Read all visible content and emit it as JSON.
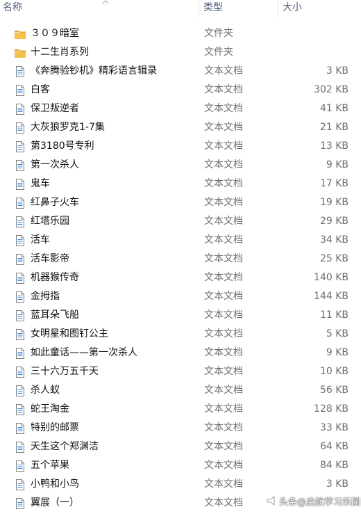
{
  "header": {
    "name_label": "名称",
    "type_label": "类型",
    "size_label": "大小"
  },
  "rows": [
    {
      "name": "３０９暗室",
      "type": "文件夹",
      "size": "",
      "icon": "folder-icon"
    },
    {
      "name": "十二生肖系列",
      "type": "文件夹",
      "size": "",
      "icon": "folder-icon"
    },
    {
      "name": "《奔腾验钞机》精彩语言辑录",
      "type": "文本文档",
      "size": "3 KB",
      "icon": "text-document-icon"
    },
    {
      "name": "白客",
      "type": "文本文档",
      "size": "302 KB",
      "icon": "text-document-icon"
    },
    {
      "name": "保卫叛逆者",
      "type": "文本文档",
      "size": "41 KB",
      "icon": "text-document-icon"
    },
    {
      "name": "大灰狼罗克1-7集",
      "type": "文本文档",
      "size": "21 KB",
      "icon": "text-document-icon"
    },
    {
      "name": "第3180号专利",
      "type": "文本文档",
      "size": "13 KB",
      "icon": "text-document-icon"
    },
    {
      "name": "第一次杀人",
      "type": "文本文档",
      "size": "9 KB",
      "icon": "text-document-icon"
    },
    {
      "name": "鬼车",
      "type": "文本文档",
      "size": "17 KB",
      "icon": "text-document-icon"
    },
    {
      "name": "红鼻子火车",
      "type": "文本文档",
      "size": "19 KB",
      "icon": "text-document-icon"
    },
    {
      "name": "红塔乐园",
      "type": "文本文档",
      "size": "29 KB",
      "icon": "text-document-icon"
    },
    {
      "name": "活车",
      "type": "文本文档",
      "size": "34 KB",
      "icon": "text-document-icon"
    },
    {
      "name": "活车影帝",
      "type": "文本文档",
      "size": "25 KB",
      "icon": "text-document-icon"
    },
    {
      "name": "机器猴传奇",
      "type": "文本文档",
      "size": "140 KB",
      "icon": "text-document-icon"
    },
    {
      "name": "金拇指",
      "type": "文本文档",
      "size": "144 KB",
      "icon": "text-document-icon"
    },
    {
      "name": "蓝耳朵飞船",
      "type": "文本文档",
      "size": "11 KB",
      "icon": "text-document-icon"
    },
    {
      "name": "女明星和图钉公主",
      "type": "文本文档",
      "size": "5 KB",
      "icon": "text-document-icon"
    },
    {
      "name": "如此童话——第一次杀人",
      "type": "文本文档",
      "size": "9 KB",
      "icon": "text-document-icon"
    },
    {
      "name": "三十六万五千天",
      "type": "文本文档",
      "size": "10 KB",
      "icon": "text-document-icon"
    },
    {
      "name": "杀人蚁",
      "type": "文本文档",
      "size": "56 KB",
      "icon": "text-document-icon"
    },
    {
      "name": "蛇王淘金",
      "type": "文本文档",
      "size": "128 KB",
      "icon": "text-document-icon"
    },
    {
      "name": "特别的邮票",
      "type": "文本文档",
      "size": "33 KB",
      "icon": "text-document-icon"
    },
    {
      "name": "天生这个郑渊洁",
      "type": "文本文档",
      "size": "64 KB",
      "icon": "text-document-icon"
    },
    {
      "name": "五个苹果",
      "type": "文本文档",
      "size": "84 KB",
      "icon": "text-document-icon"
    },
    {
      "name": "小鸭和小鸟",
      "type": "文本文档",
      "size": "3 KB",
      "icon": "text-document-icon"
    },
    {
      "name": "翼展（一）",
      "type": "文本文档",
      "size": "",
      "icon": "text-document-icon"
    }
  ],
  "watermark": {
    "text": "头条@启航学习乐园",
    "icon": "megaphone-icon"
  },
  "colors": {
    "folder": "#f2c14e",
    "folder_dark": "#dba73a",
    "document_border": "#7f7f7f",
    "document_lines": "#3a87d6",
    "header_text": "#4d5b78",
    "secondary_text": "#6d6d6d"
  }
}
